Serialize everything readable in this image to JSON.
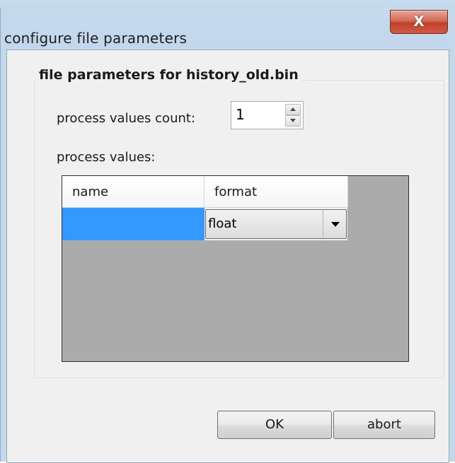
{
  "window": {
    "title": "configure file parameters",
    "close_label": "X"
  },
  "group": {
    "title": "file parameters for history_old.bin"
  },
  "count": {
    "label": "process values count:",
    "value": "1"
  },
  "values": {
    "label": "process values:"
  },
  "grid": {
    "columns": [
      "name",
      "format"
    ],
    "rows": [
      {
        "name": "",
        "format": "float"
      }
    ]
  },
  "buttons": {
    "ok_label": "OK",
    "abort_label": "abort"
  },
  "colors": {
    "selection": "#3399ff",
    "grid_background": "#ababab",
    "close_button": "#c7503a"
  },
  "icons": [
    "close-icon",
    "spin-up-icon",
    "spin-down-icon",
    "dropdown-arrow-icon"
  ]
}
